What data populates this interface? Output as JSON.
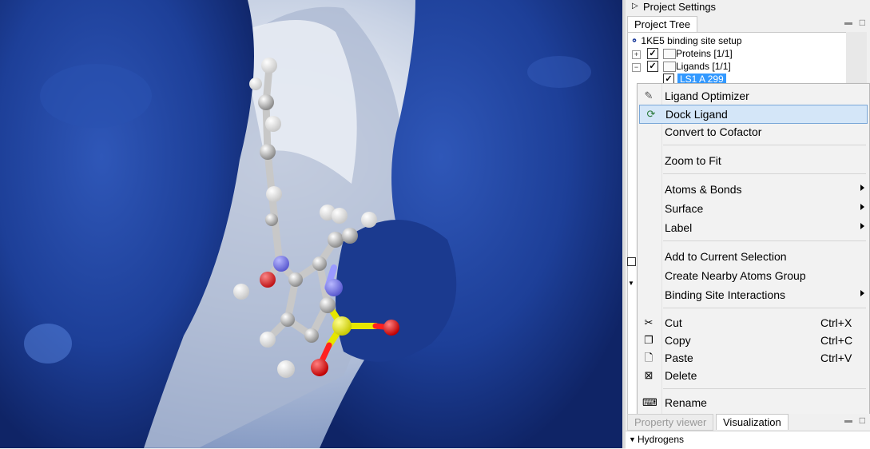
{
  "panel": {
    "title": "Project Settings",
    "tab": "Project Tree"
  },
  "tree": {
    "root": "1KE5 binding site setup",
    "items": [
      {
        "label": "Proteins [1/1]",
        "checked": true
      },
      {
        "label": "Ligands [1/1]",
        "checked": true
      },
      {
        "label": "LS1 A 299",
        "checked": true,
        "selected": true
      }
    ]
  },
  "context_menu": {
    "items": [
      {
        "label": "Ligand Optimizer",
        "icon": "ligand-optimizer-icon"
      },
      {
        "label": "Dock Ligand",
        "icon": "dock-ligand-icon",
        "highlighted": true
      },
      {
        "label": "Convert to Cofactor"
      },
      {
        "label": "Zoom to Fit"
      },
      {
        "label": "Atoms & Bonds",
        "submenu": true
      },
      {
        "label": "Surface",
        "submenu": true
      },
      {
        "label": "Label",
        "submenu": true
      },
      {
        "label": "Add to Current Selection"
      },
      {
        "label": "Create Nearby Atoms Group"
      },
      {
        "label": "Binding Site Interactions",
        "submenu": true
      },
      {
        "label": "Cut",
        "shortcut": "Ctrl+X",
        "icon": "scissors-icon"
      },
      {
        "label": "Copy",
        "shortcut": "Ctrl+C",
        "icon": "copy-icon"
      },
      {
        "label": "Paste",
        "shortcut": "Ctrl+V",
        "icon": "paste-icon"
      },
      {
        "label": "Delete",
        "icon": "delete-icon"
      },
      {
        "label": "Rename",
        "icon": "rename-icon"
      }
    ]
  },
  "bottom_tabs": {
    "inactive": "Property viewer",
    "active": "Visualization"
  },
  "visualization": {
    "section": "Hydrogens"
  },
  "colors": {
    "surface": "#1e3f95",
    "selection": "#3399ff",
    "menu_highlight": "#d4e6f8"
  }
}
